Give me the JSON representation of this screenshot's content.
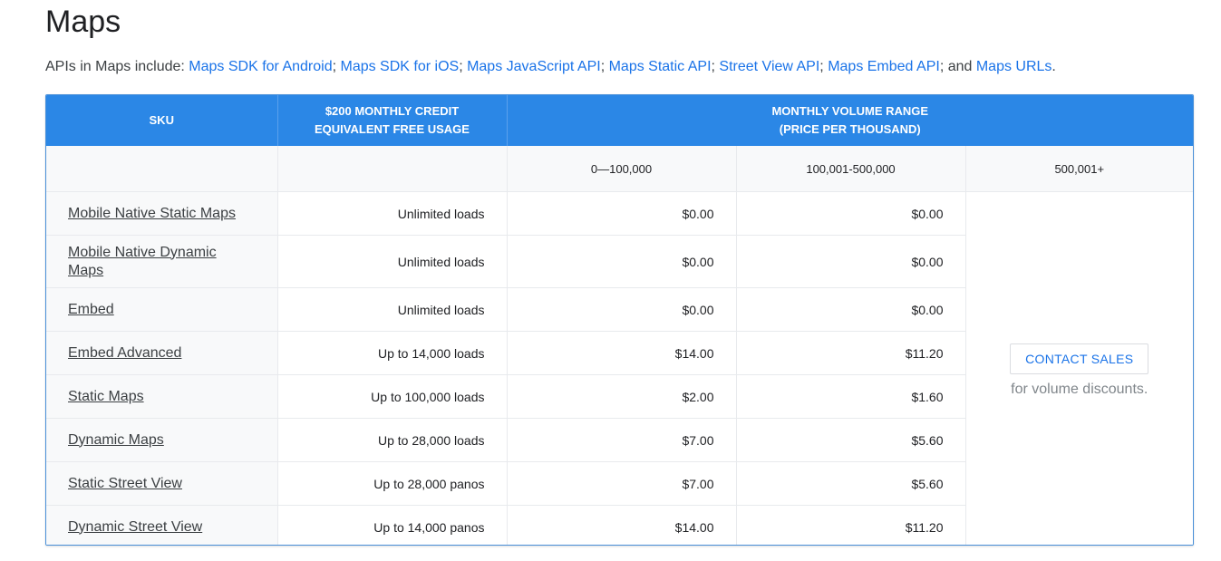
{
  "page": {
    "title": "Maps",
    "intro_prefix": "APIs in Maps include: ",
    "links": [
      {
        "label": "Maps SDK for Android",
        "sep": "; "
      },
      {
        "label": "Maps SDK for iOS",
        "sep": "; "
      },
      {
        "label": "Maps JavaScript API",
        "sep": "; "
      },
      {
        "label": "Maps Static API",
        "sep": "; "
      },
      {
        "label": "Street View API",
        "sep": "; "
      },
      {
        "label": "Maps Embed API",
        "sep": "; and "
      },
      {
        "label": "Maps URLs",
        "sep": "."
      }
    ]
  },
  "table": {
    "headers": {
      "sku": "SKU",
      "credit_line1": "$200 MONTHLY CREDIT",
      "credit_line2": "EQUIVALENT FREE USAGE",
      "range_line1": "MONTHLY VOLUME RANGE",
      "range_line2": "(PRICE PER THOUSAND)"
    },
    "ranges": [
      "0—100,000",
      "100,001-500,000",
      "500,001+"
    ],
    "rows": [
      {
        "sku": "Mobile Native Static Maps",
        "free": "Unlimited loads",
        "p1": "$0.00",
        "p2": "$0.00"
      },
      {
        "sku": "Mobile Native Dynamic Maps",
        "free": "Unlimited loads",
        "p1": "$0.00",
        "p2": "$0.00"
      },
      {
        "sku": "Embed",
        "free": "Unlimited loads",
        "p1": "$0.00",
        "p2": "$0.00"
      },
      {
        "sku": "Embed Advanced",
        "free": "Up to 14,000 loads",
        "p1": "$14.00",
        "p2": "$11.20"
      },
      {
        "sku": "Static Maps",
        "free": "Up to 100,000 loads",
        "p1": "$2.00",
        "p2": "$1.60"
      },
      {
        "sku": "Dynamic Maps",
        "free": "Up to 28,000 loads",
        "p1": "$7.00",
        "p2": "$5.60"
      },
      {
        "sku": "Static Street View",
        "free": "Up to 28,000 panos",
        "p1": "$7.00",
        "p2": "$5.60"
      },
      {
        "sku": "Dynamic Street View",
        "free": "Up to 14,000 panos",
        "p1": "$14.00",
        "p2": "$11.20"
      }
    ],
    "contact_label": "CONTACT SALES",
    "contact_note": "for volume discounts."
  },
  "colors": {
    "header_bg": "#2b87e6",
    "link": "#1a73e8",
    "text": "#3c4043"
  }
}
